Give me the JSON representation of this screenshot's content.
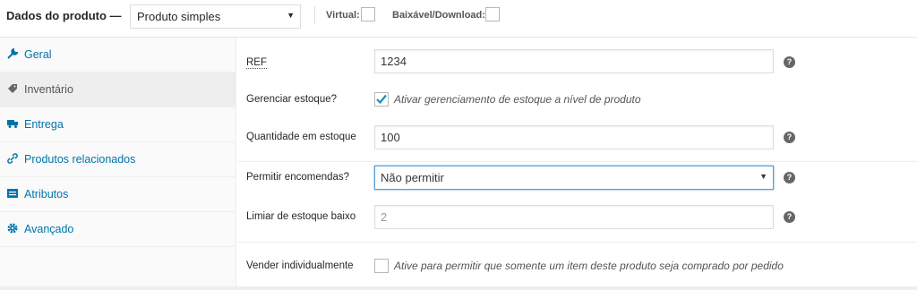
{
  "header": {
    "title": "Dados do produto —",
    "product_type": "Produto simples",
    "virtual_label": "Virtual:",
    "download_label": "Baixável/Download:"
  },
  "sidebar": {
    "items": [
      {
        "label": "Geral",
        "icon": "wrench-icon",
        "active": false
      },
      {
        "label": "Inventário",
        "icon": "tag-icon",
        "active": true
      },
      {
        "label": "Entrega",
        "icon": "truck-icon",
        "active": false
      },
      {
        "label": "Produtos relacionados",
        "icon": "link-icon",
        "active": false
      },
      {
        "label": "Atributos",
        "icon": "table-icon",
        "active": false
      },
      {
        "label": "Avançado",
        "icon": "gear-icon",
        "active": false
      }
    ]
  },
  "inventory": {
    "sku_label": "REF",
    "sku_value": "1234",
    "manage_stock_label": "Gerenciar estoque?",
    "manage_stock_desc": "Ativar gerenciamento de estoque a nível de produto",
    "manage_stock_checked": true,
    "stock_qty_label": "Quantidade em estoque",
    "stock_qty_value": "100",
    "backorders_label": "Permitir encomendas?",
    "backorders_value": "Não permitir",
    "low_stock_label": "Limiar de estoque baixo",
    "low_stock_placeholder": "2",
    "sold_individually_label": "Vender individualmente",
    "sold_individually_desc": "Ative para permitir que somente um item deste produto seja comprado por pedido",
    "help_glyph": "?"
  },
  "colors": {
    "link": "#0073aa",
    "active_bg": "#eeeeee",
    "focus_border": "#5b9dd9",
    "check": "#1e8cbe"
  }
}
